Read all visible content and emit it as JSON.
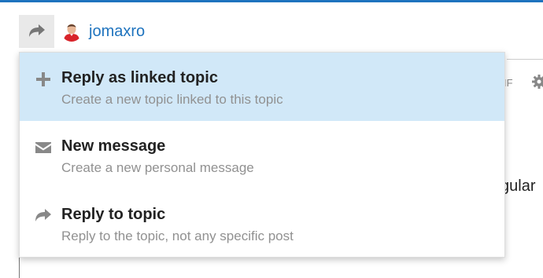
{
  "header": {
    "username": "jomaxro",
    "share_icon": "share-arrow-icon",
    "avatar_icon": "user-avatar"
  },
  "background": {
    "gif_label": "IF",
    "gear_icon": "gear-icon",
    "partial_text": "gular"
  },
  "menu": {
    "items": [
      {
        "title": "Reply as linked topic",
        "description": "Create a new topic linked to this topic",
        "icon": "plus-icon",
        "selected": true
      },
      {
        "title": "New message",
        "description": "Create a new personal message",
        "icon": "envelope-icon",
        "selected": false
      },
      {
        "title": "Reply to topic",
        "description": "Reply to the topic, not any specific post",
        "icon": "reply-arrow-icon",
        "selected": false
      }
    ]
  },
  "colors": {
    "link": "#1e73be",
    "selected_bg": "#d1e8f8",
    "muted_text": "#919191",
    "icon_gray": "#888888"
  }
}
